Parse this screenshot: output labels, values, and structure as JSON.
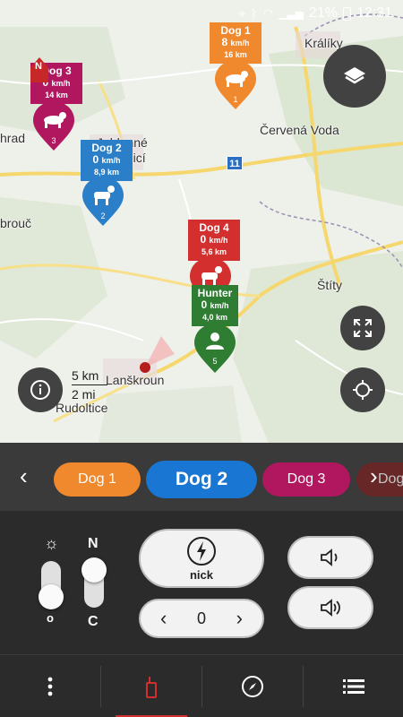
{
  "status_bar": {
    "battery": "21%",
    "time": "12:31"
  },
  "map": {
    "places": [
      {
        "name": "Králíky"
      },
      {
        "name": "Červená Voda"
      },
      {
        "name": "hrad"
      },
      {
        "name": "Jablonné"
      },
      {
        "name": "Orlicí"
      },
      {
        "name": "brouč"
      },
      {
        "name": "Štíty"
      },
      {
        "name": "Lanškroun"
      },
      {
        "name": "Rudoltice"
      }
    ],
    "road_number": "11",
    "scale": {
      "km": "5 km",
      "mi": "2 mi"
    },
    "north_label": "N",
    "dogs": [
      {
        "name": "Dog 1",
        "speed_value": "8",
        "speed_unit": "km/h",
        "distance": "16 km",
        "number": "1",
        "color": "#f0892e",
        "icon": "dog-running-icon"
      },
      {
        "name": "Dog 3",
        "speed_value": "0",
        "speed_unit": "km/h",
        "distance": "14 km",
        "number": "3",
        "color": "#b0175f",
        "icon": "dog-running-icon"
      },
      {
        "name": "Dog 2",
        "speed_value": "0",
        "speed_unit": "km/h",
        "distance": "8,9 km",
        "number": "2",
        "color": "#2a7fc8",
        "icon": "dog-standing-icon"
      },
      {
        "name": "Dog 4",
        "speed_value": "0",
        "speed_unit": "km/h",
        "distance": "5,6 km",
        "number": "4",
        "color": "#d32f2f",
        "icon": "dog-standing-icon"
      },
      {
        "name": "Hunter",
        "speed_value": "0",
        "speed_unit": "km/h",
        "distance": "4,0 km",
        "number": "5",
        "color": "#2e7d32",
        "icon": "person-icon"
      }
    ]
  },
  "dog_selector": {
    "items": [
      {
        "label": "Dog 1",
        "color": "#f0892e"
      },
      {
        "label": "Dog 2",
        "color": "#1976d2"
      },
      {
        "label": "Dog 3",
        "color": "#b0175f"
      },
      {
        "label": "Dog",
        "color": "#7a1f1f"
      }
    ]
  },
  "controls": {
    "light_top": "☼",
    "light_bottom": "o",
    "mode_top": "N",
    "mode_bottom": "C",
    "stim_label": "nick",
    "level_value": "0"
  }
}
